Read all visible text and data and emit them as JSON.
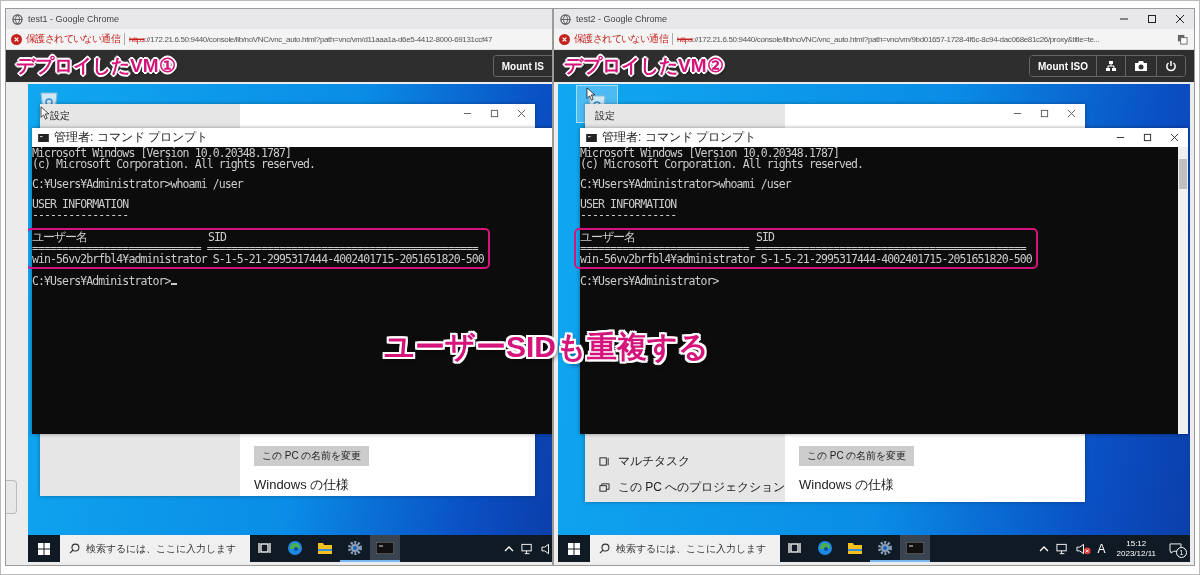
{
  "windows": [
    {
      "title": "test1 - Google Chrome",
      "window_controls": false,
      "security": "保護されていない通信",
      "url_scheme": "https",
      "url_rest": "://172.21.6.50:9440/console/lib/noVNC/vnc_auto.html?path=vnc/vm/d11aaa1a-d6e5-4412-8000-69131ccf47",
      "translate": false,
      "vm_label": "デプロイしたVM①",
      "control_bar_handle": true,
      "toolbar": [
        {
          "kind": "text",
          "label": "Mount IS"
        }
      ],
      "desktop": {
        "icon_selected": false,
        "settings": {
          "title": "設定",
          "rename_button": "この PC の名前を変更",
          "heading": "Windows の仕様"
        },
        "console": {
          "title": "管理者: コマンド プロンプト",
          "window_controls": false,
          "scrollbar": false,
          "cursor": true,
          "blocks": [
            {
              "highlighted": false,
              "lines": [
                "Microsoft Windows [Version 10.0.20348.1787]",
                "(c) Microsoft Corporation. All rights reserved."
              ]
            },
            {
              "highlighted": false,
              "lines": [
                "C:¥Users¥Administrator>whoami /user"
              ]
            },
            {
              "highlighted": false,
              "lines": [
                "USER INFORMATION",
                "----------------"
              ]
            },
            {
              "highlighted": true,
              "lines": [
                "ユーザー名                    SID",
                "============================ =============================================",
                "win-56vv2brfbl4¥administrator S-1-5-21-2995317444-4002401715-2051651820-500"
              ]
            },
            {
              "highlighted": false,
              "lines": [
                "C:¥Users¥Administrator>"
              ]
            }
          ]
        }
      },
      "taskbar": {
        "search_placeholder": "検索するには、ここに入力します",
        "apps": [
          {
            "kind": "task-view",
            "running": false,
            "active": false
          },
          {
            "kind": "browser",
            "running": false,
            "active": false
          },
          {
            "kind": "folder",
            "running": false,
            "active": false
          },
          {
            "kind": "gear",
            "running": true,
            "active": false
          },
          {
            "kind": "terminal",
            "running": true,
            "active": true
          }
        ],
        "muted": false
      }
    },
    {
      "title": "test2 - Google Chrome",
      "window_controls": true,
      "security": "保護されていない通信",
      "url_scheme": "https",
      "url_rest": "://172.21.6.50:9440/console/lib/noVNC/vnc_auto.html?path=vnc/vm/9bd01657-1728-4f6c-8c94-dac068e81c26/proxy&title=te...",
      "translate": true,
      "vm_label": "デプロイしたVM②",
      "control_bar_handle": false,
      "toolbar": [
        {
          "kind": "text",
          "label": "Mount ISO"
        },
        {
          "kind": "network"
        },
        {
          "kind": "camera"
        },
        {
          "kind": "power"
        }
      ],
      "desktop": {
        "icon_selected": true,
        "settings": {
          "title": "設定",
          "sidebar": [
            {
              "kind": "multitask",
              "label": "マルチタスク"
            },
            {
              "kind": "projection",
              "label": "この PC へのプロジェクション"
            }
          ],
          "rename_button": "この PC の名前を変更",
          "heading": "Windows の仕様"
        },
        "console": {
          "title": "管理者: コマンド プロンプト",
          "window_controls": true,
          "scrollbar": true,
          "cursor": false,
          "blocks": [
            {
              "highlighted": false,
              "lines": [
                "Microsoft Windows [Version 10.0.20348.1787]",
                "(c) Microsoft Corporation. All rights reserved."
              ]
            },
            {
              "highlighted": false,
              "lines": [
                "C:¥Users¥Administrator>whoami /user"
              ]
            },
            {
              "highlighted": false,
              "lines": [
                "USER INFORMATION",
                "----------------"
              ]
            },
            {
              "highlighted": true,
              "lines": [
                "ユーザー名                    SID",
                "============================ =============================================",
                "win-56vv2brfbl4¥administrator S-1-5-21-2995317444-4002401715-2051651820-500"
              ]
            },
            {
              "highlighted": false,
              "lines": [
                "C:¥Users¥Administrator>"
              ]
            }
          ]
        }
      },
      "taskbar": {
        "search_placeholder": "検索するには、ここに入力します",
        "apps": [
          {
            "kind": "task-view",
            "running": false,
            "active": false
          },
          {
            "kind": "browser",
            "running": false,
            "active": false
          },
          {
            "kind": "folder",
            "running": false,
            "active": false
          },
          {
            "kind": "gear",
            "running": true,
            "active": false
          },
          {
            "kind": "terminal",
            "running": true,
            "active": true
          }
        ],
        "muted": true,
        "ime": "A",
        "time": "15:12",
        "date": "2023/12/11",
        "notifications": "1"
      }
    }
  ],
  "caption": "ユーザーSIDも重複する"
}
